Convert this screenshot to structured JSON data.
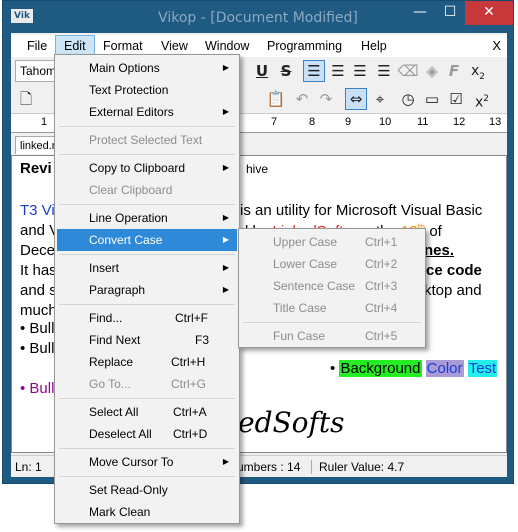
{
  "window": {
    "app_icon_text": "Vik",
    "title": "Vikop - [Document Modified]",
    "controls": {
      "minimize": "—",
      "maximize": "☐",
      "close": "✕"
    }
  },
  "menubar": {
    "items": [
      "File",
      "Edit",
      "Format",
      "View",
      "Window",
      "Programming",
      "Help"
    ],
    "close_glyph": "X"
  },
  "toolbar": {
    "font_name": "Tahoma",
    "subscript_label": "x",
    "subscript_sub": "2",
    "superscript_label": "x",
    "superscript_sup": "2"
  },
  "ruler": {
    "numbers": [
      "1",
      "7",
      "8",
      "9",
      "10",
      "11",
      "12",
      "13"
    ]
  },
  "tab": {
    "label": "linked.r"
  },
  "document": {
    "line1a": "Revi",
    "line1b": "hive",
    "line2a": "T3 Vi",
    "line2b": "is an utility for Microsoft Visual Basic",
    "line3a": "and V",
    "line3b": "d by ",
    "line3c": "LinkedSofts",
    "line3d": " on the ",
    "line3e": "13",
    "line3f": "th",
    "line3g": " of",
    "line4a": "Decer",
    "line4b": "nes",
    "line4c": ".",
    "line5a": "It has",
    "line5b": "ce code",
    "line6a": "and s",
    "line6b": "ktop and",
    "line7": "much",
    "bullet1": "• Bull",
    "bullet2": "• Bull",
    "bullet3": "• Bull",
    "bg_bullet": "•",
    "bg_word1": "Background",
    "bg_word2": "Color",
    "bg_word3": "Test",
    "signature": "edSofts"
  },
  "statusbar": {
    "position": "Ln: 1",
    "numbers": "umbers : 14",
    "ruler_value": "Ruler Value: 4.7"
  },
  "edit_menu": {
    "items": [
      {
        "label": "Main Options",
        "shortcut": "",
        "submenu": true,
        "disabled": false
      },
      {
        "label": "Text Protection",
        "shortcut": "",
        "submenu": false,
        "disabled": false
      },
      {
        "label": "External Editors",
        "shortcut": "",
        "submenu": true,
        "disabled": false
      },
      {
        "label": "Protect Selected Text",
        "shortcut": "",
        "submenu": false,
        "disabled": true
      },
      {
        "label": "Copy to Clipboard",
        "shortcut": "",
        "submenu": true,
        "disabled": false
      },
      {
        "label": "Clear Clipboard",
        "shortcut": "",
        "submenu": false,
        "disabled": true
      },
      {
        "label": "Line Operation",
        "shortcut": "",
        "submenu": true,
        "disabled": false
      },
      {
        "label": "Convert Case",
        "shortcut": "",
        "submenu": true,
        "disabled": false,
        "highlighted": true
      },
      {
        "label": "Insert",
        "shortcut": "",
        "submenu": true,
        "disabled": false
      },
      {
        "label": "Paragraph",
        "shortcut": "",
        "submenu": true,
        "disabled": false
      },
      {
        "label": "Find...",
        "shortcut": "Ctrl+F",
        "submenu": false,
        "disabled": false
      },
      {
        "label": "Find Next",
        "shortcut": "F3",
        "submenu": false,
        "disabled": false
      },
      {
        "label": "Replace",
        "shortcut": "Ctrl+H",
        "submenu": false,
        "disabled": false
      },
      {
        "label": "Go To...",
        "shortcut": "Ctrl+G",
        "submenu": false,
        "disabled": true
      },
      {
        "label": "Select All",
        "shortcut": "Ctrl+A",
        "submenu": false,
        "disabled": false
      },
      {
        "label": "Deselect All",
        "shortcut": "Ctrl+D",
        "submenu": false,
        "disabled": false
      },
      {
        "label": "Move Cursor To",
        "shortcut": "",
        "submenu": true,
        "disabled": false
      },
      {
        "label": "Set Read-Only",
        "shortcut": "",
        "submenu": false,
        "disabled": false
      },
      {
        "label": "Mark Clean",
        "shortcut": "",
        "submenu": false,
        "disabled": false
      }
    ]
  },
  "case_menu": {
    "items": [
      {
        "label": "Upper Case",
        "shortcut": "Ctrl+1"
      },
      {
        "label": "Lower Case",
        "shortcut": "Ctrl+2"
      },
      {
        "label": "Sentence Case",
        "shortcut": "Ctrl+3"
      },
      {
        "label": "Title Case",
        "shortcut": "Ctrl+4"
      },
      {
        "label": "Fun Case",
        "shortcut": "Ctrl+5"
      }
    ]
  },
  "colors": {
    "titlebar": "#1f5a82",
    "close_button": "#c7383a",
    "menu_highlight": "#2e8ad8",
    "link_red": "#ff1a1a",
    "date_orange": "#ff8800",
    "blue_text": "#1a3bd8",
    "purple_text": "#8b0a8b",
    "bg_green": "#22ee22",
    "bg_purple": "#a99bd6",
    "bg_cyan": "#22eeee"
  }
}
